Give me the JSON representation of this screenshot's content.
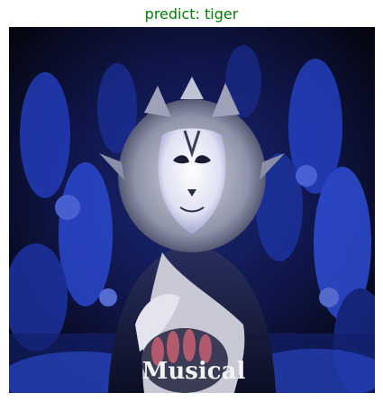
{
  "title": {
    "text": "predict: tiger",
    "color": "#008000"
  },
  "image": {
    "subject": "stage performer in cat costume",
    "watermark_text": "Musical",
    "colors": {
      "background": "#0a0c2a",
      "blue_highlight": "#3b5cff",
      "face": "#e8e8f5",
      "mane": "#b8b8c8",
      "shadow": "#05060f"
    }
  }
}
